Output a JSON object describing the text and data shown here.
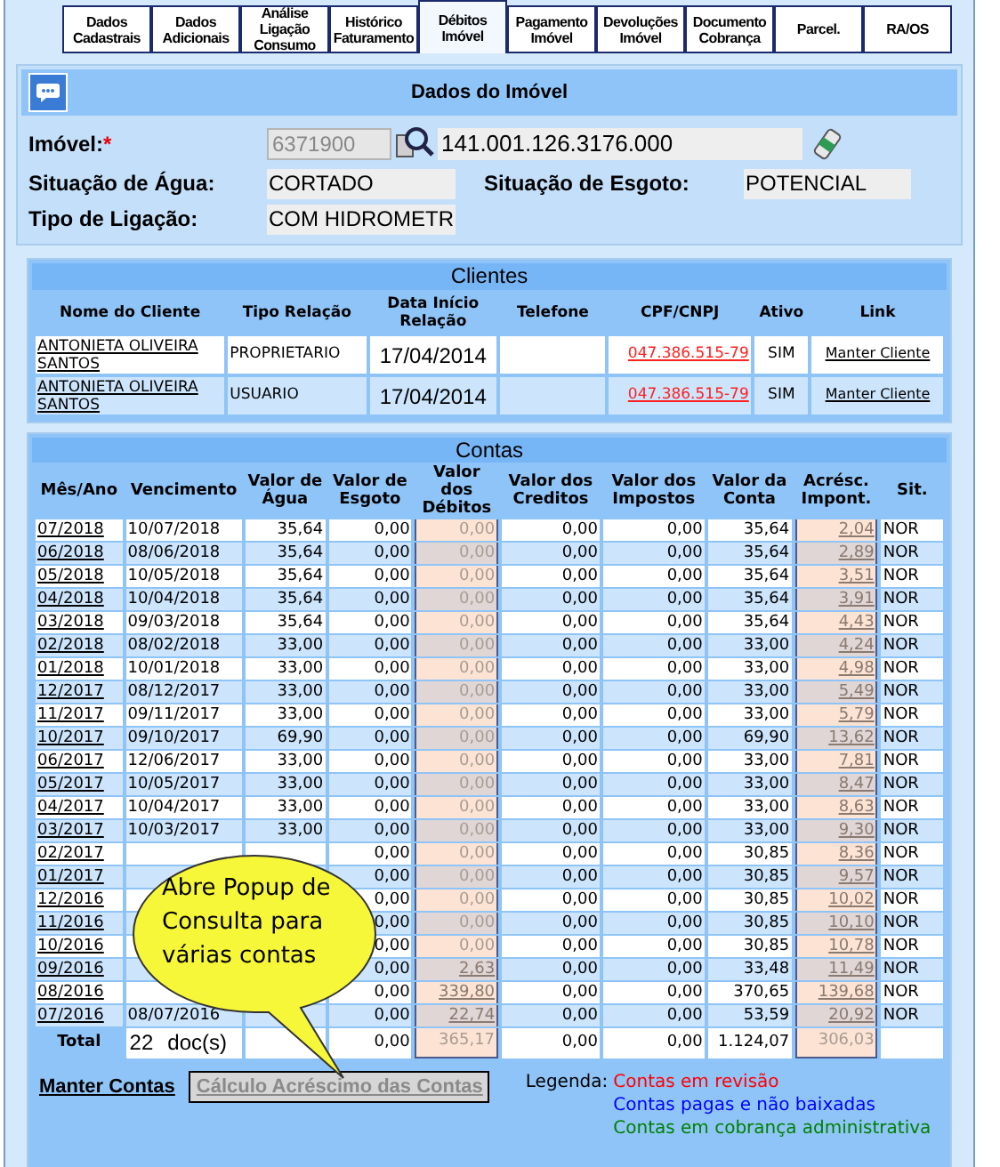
{
  "tabs": [
    {
      "label": "Dados Cadastrais",
      "selected": false
    },
    {
      "label": "Dados Adicionais",
      "selected": false
    },
    {
      "label": "Análise Ligação Consumo",
      "selected": false
    },
    {
      "label": "Histórico Faturamento",
      "selected": false
    },
    {
      "label": "Débitos Imóvel",
      "selected": true
    },
    {
      "label": "Pagamento Imóvel",
      "selected": false
    },
    {
      "label": "Devoluções Imóvel",
      "selected": false
    },
    {
      "label": "Documento Cobrança",
      "selected": false
    },
    {
      "label": "Parcel.",
      "selected": false
    },
    {
      "label": "RA/OS",
      "selected": false
    }
  ],
  "imovel": {
    "title": "Dados do Imóvel",
    "label": "Imóvel:",
    "required": "*",
    "matricula": "6371900",
    "inscricao": "141.001.126.3176.000",
    "situacao_agua_label": "Situação de Água:",
    "situacao_agua": "CORTADO",
    "situacao_esgoto_label": "Situação de Esgoto:",
    "situacao_esgoto": "POTENCIAL",
    "tipo_ligacao_label": "Tipo de Ligação:",
    "tipo_ligacao": "COM HIDROMETR"
  },
  "clientes": {
    "title": "Clientes",
    "columns": [
      "Nome do Cliente",
      "Tipo Relação",
      "Data Início Relação",
      "Telefone",
      "CPF/CNPJ",
      "Ativo",
      "Link"
    ],
    "rows": [
      {
        "nome": "ANTONIETA OLIVEIRA SANTOS",
        "tipo": "PROPRIETARIO",
        "data": "17/04/2014",
        "cpf": "047.386.515-79",
        "ativo": "SIM",
        "link": "Manter Cliente"
      },
      {
        "nome": "ANTONIETA OLIVEIRA SANTOS",
        "tipo": "USUARIO",
        "data": "17/04/2014",
        "cpf": "047.386.515-79",
        "ativo": "SIM",
        "link": "Manter Cliente"
      }
    ]
  },
  "contas": {
    "title": "Contas",
    "columns": [
      "Mês/Ano",
      "Vencimento",
      "Valor de Água",
      "Valor de Esgoto",
      "Valor dos Débitos",
      "Valor dos Creditos",
      "Valor dos Impostos",
      "Valor da Conta",
      "Acrésc. Impont.",
      "Sit."
    ],
    "rows": [
      {
        "mes": "07/2018",
        "venc": "10/07/2018",
        "agua": "35,64",
        "esgoto": "0,00",
        "debitos": "0,00",
        "creditos": "0,00",
        "impostos": "0,00",
        "conta": "35,64",
        "acresc": "2,04",
        "sit": "NOR"
      },
      {
        "mes": "06/2018",
        "venc": "08/06/2018",
        "agua": "35,64",
        "esgoto": "0,00",
        "debitos": "0,00",
        "creditos": "0,00",
        "impostos": "0,00",
        "conta": "35,64",
        "acresc": "2,89",
        "sit": "NOR"
      },
      {
        "mes": "05/2018",
        "venc": "10/05/2018",
        "agua": "35,64",
        "esgoto": "0,00",
        "debitos": "0,00",
        "creditos": "0,00",
        "impostos": "0,00",
        "conta": "35,64",
        "acresc": "3,51",
        "sit": "NOR"
      },
      {
        "mes": "04/2018",
        "venc": "10/04/2018",
        "agua": "35,64",
        "esgoto": "0,00",
        "debitos": "0,00",
        "creditos": "0,00",
        "impostos": "0,00",
        "conta": "35,64",
        "acresc": "3,91",
        "sit": "NOR"
      },
      {
        "mes": "03/2018",
        "venc": "09/03/2018",
        "agua": "35,64",
        "esgoto": "0,00",
        "debitos": "0,00",
        "creditos": "0,00",
        "impostos": "0,00",
        "conta": "35,64",
        "acresc": "4,43",
        "sit": "NOR"
      },
      {
        "mes": "02/2018",
        "venc": "08/02/2018",
        "agua": "33,00",
        "esgoto": "0,00",
        "debitos": "0,00",
        "creditos": "0,00",
        "impostos": "0,00",
        "conta": "33,00",
        "acresc": "4,24",
        "sit": "NOR"
      },
      {
        "mes": "01/2018",
        "venc": "10/01/2018",
        "agua": "33,00",
        "esgoto": "0,00",
        "debitos": "0,00",
        "creditos": "0,00",
        "impostos": "0,00",
        "conta": "33,00",
        "acresc": "4,98",
        "sit": "NOR"
      },
      {
        "mes": "12/2017",
        "venc": "08/12/2017",
        "agua": "33,00",
        "esgoto": "0,00",
        "debitos": "0,00",
        "creditos": "0,00",
        "impostos": "0,00",
        "conta": "33,00",
        "acresc": "5,49",
        "sit": "NOR"
      },
      {
        "mes": "11/2017",
        "venc": "09/11/2017",
        "agua": "33,00",
        "esgoto": "0,00",
        "debitos": "0,00",
        "creditos": "0,00",
        "impostos": "0,00",
        "conta": "33,00",
        "acresc": "5,79",
        "sit": "NOR"
      },
      {
        "mes": "10/2017",
        "venc": "09/10/2017",
        "agua": "69,90",
        "esgoto": "0,00",
        "debitos": "0,00",
        "creditos": "0,00",
        "impostos": "0,00",
        "conta": "69,90",
        "acresc": "13,62",
        "sit": "NOR"
      },
      {
        "mes": "06/2017",
        "venc": "12/06/2017",
        "agua": "33,00",
        "esgoto": "0,00",
        "debitos": "0,00",
        "creditos": "0,00",
        "impostos": "0,00",
        "conta": "33,00",
        "acresc": "7,81",
        "sit": "NOR"
      },
      {
        "mes": "05/2017",
        "venc": "10/05/2017",
        "agua": "33,00",
        "esgoto": "0,00",
        "debitos": "0,00",
        "creditos": "0,00",
        "impostos": "0,00",
        "conta": "33,00",
        "acresc": "8,47",
        "sit": "NOR"
      },
      {
        "mes": "04/2017",
        "venc": "10/04/2017",
        "agua": "33,00",
        "esgoto": "0,00",
        "debitos": "0,00",
        "creditos": "0,00",
        "impostos": "0,00",
        "conta": "33,00",
        "acresc": "8,63",
        "sit": "NOR"
      },
      {
        "mes": "03/2017",
        "venc": "10/03/2017",
        "agua": "33,00",
        "esgoto": "0,00",
        "debitos": "0,00",
        "creditos": "0,00",
        "impostos": "0,00",
        "conta": "33,00",
        "acresc": "9,30",
        "sit": "NOR"
      },
      {
        "mes": "02/2017",
        "esgoto": "0,00",
        "debitos": "0,00",
        "creditos": "0,00",
        "impostos": "0,00",
        "conta": "30,85",
        "acresc": "8,36",
        "sit": "NOR"
      },
      {
        "mes": "01/2017",
        "esgoto": "0,00",
        "debitos": "0,00",
        "creditos": "0,00",
        "impostos": "0,00",
        "conta": "30,85",
        "acresc": "9,57",
        "sit": "NOR"
      },
      {
        "mes": "12/2016",
        "esgoto": "0,00",
        "debitos": "0,00",
        "creditos": "0,00",
        "impostos": "0,00",
        "conta": "30,85",
        "acresc": "10,02",
        "sit": "NOR"
      },
      {
        "mes": "11/2016",
        "esgoto": "0,00",
        "debitos": "0,00",
        "creditos": "0,00",
        "impostos": "0,00",
        "conta": "30,85",
        "acresc": "10,10",
        "sit": "NOR"
      },
      {
        "mes": "10/2016",
        "esgoto": "0,00",
        "debitos": "0,00",
        "creditos": "0,00",
        "impostos": "0,00",
        "conta": "30,85",
        "acresc": "10,78",
        "sit": "NOR"
      },
      {
        "mes": "09/2016",
        "esgoto": "0,00",
        "debitos": "2,63",
        "creditos": "0,00",
        "impostos": "0,00",
        "conta": "33,48",
        "acresc": "11,49",
        "sit": "NOR"
      },
      {
        "mes": "08/2016",
        "esgoto": "0,00",
        "debitos": "339,80",
        "creditos": "0,00",
        "impostos": "0,00",
        "conta": "370,65",
        "acresc": "139,68",
        "sit": "NOR"
      },
      {
        "mes": "07/2016",
        "venc": "08/07/2016",
        "esgoto": "0,00",
        "debitos": "22,74",
        "creditos": "0,00",
        "impostos": "0,00",
        "conta": "53,59",
        "acresc": "20,92",
        "sit": "NOR"
      }
    ],
    "total": {
      "label": "Total",
      "count": "22",
      "docs": "doc(s)",
      "esgoto": "0,00",
      "debitos": "365,17",
      "creditos": "0,00",
      "impostos": "0,00",
      "conta": "1.124,07",
      "acresc": "306,03"
    }
  },
  "manter_contas": "Manter Contas",
  "calculo_button": "Cálculo Acréscimo das Contas",
  "legenda": {
    "label": "Legenda:",
    "items": [
      {
        "text": "Contas em revisão",
        "color": "#ff0000"
      },
      {
        "text": "Contas pagas e não baixadas",
        "color": "#0000ff"
      },
      {
        "text": "Contas em cobrança administrativa",
        "color": "#008000"
      }
    ]
  },
  "callout": {
    "text": "Abre Popup de Consulta para várias contas"
  }
}
